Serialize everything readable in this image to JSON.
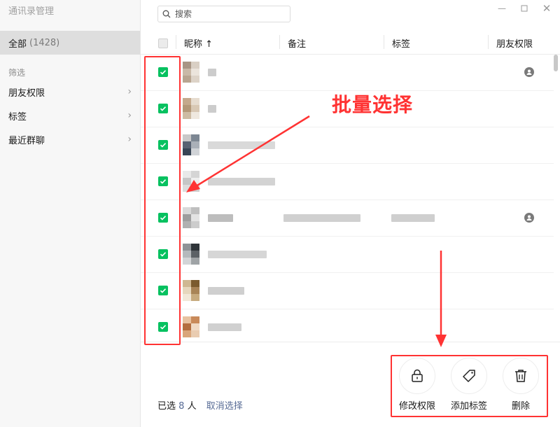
{
  "app": {
    "title": "通讯录管理"
  },
  "sidebar": {
    "all_label": "全部",
    "all_count": "(1428)",
    "filter_heading": "筛选",
    "items": [
      {
        "label": "朋友权限"
      },
      {
        "label": "标签"
      },
      {
        "label": "最近群聊"
      }
    ]
  },
  "search": {
    "placeholder": "搜索"
  },
  "window_controls": [
    "minimize-icon",
    "maximize-icon",
    "close-icon"
  ],
  "table": {
    "columns": [
      "昵称 ↑",
      "备注",
      "标签",
      "朋友权限"
    ],
    "rows": [
      {
        "checked": true,
        "has_permission_icon": true
      },
      {
        "checked": true,
        "has_permission_icon": false
      },
      {
        "checked": true,
        "has_permission_icon": false
      },
      {
        "checked": true,
        "has_permission_icon": false
      },
      {
        "checked": true,
        "has_permission_icon": true
      },
      {
        "checked": true,
        "has_permission_icon": false
      },
      {
        "checked": true,
        "has_permission_icon": false
      },
      {
        "checked": true,
        "has_permission_icon": false
      }
    ]
  },
  "footer": {
    "selected_prefix": "已选",
    "selected_count": "8",
    "selected_unit": "人",
    "cancel_label": "取消选择",
    "actions": [
      {
        "label": "修改权限",
        "icon": "lock-icon"
      },
      {
        "label": "添加标签",
        "icon": "tag-icon"
      },
      {
        "label": "删除",
        "icon": "trash-icon"
      }
    ]
  },
  "annotation": {
    "text": "批量选择",
    "color": "#ff3333"
  },
  "colors": {
    "accent": "#07c160",
    "link": "#576b95",
    "highlight": "#ff3333"
  }
}
